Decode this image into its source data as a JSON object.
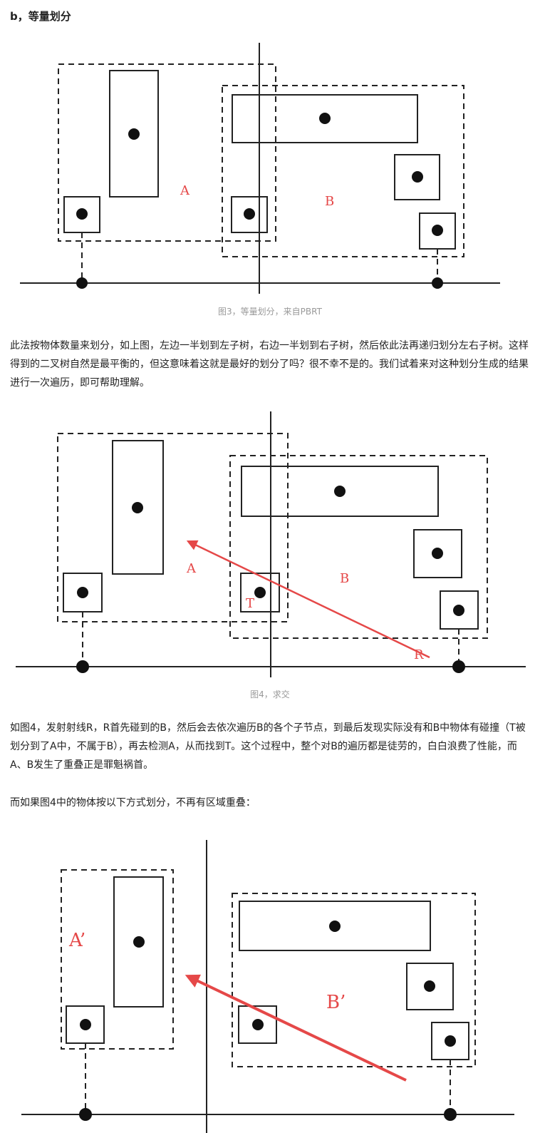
{
  "heading": "b，等量划分",
  "figure3": {
    "caption": "图3，等量划分，来自PBRT",
    "label_a": "A",
    "label_b": "B"
  },
  "paragraph1": "此法按物体数量来划分，如上图，左边一半划到左子树，右边一半划到右子树，然后依此法再递归划分左右子树。这样得到的二叉树自然是最平衡的，但这意味着这就是最好的划分了吗？很不幸不是的。我们试着来对这种划分生成的结果进行一次遍历，即可帮助理解。",
  "figure4": {
    "caption": "图4，求交",
    "label_a": "A",
    "label_b": "B",
    "label_t": "T",
    "label_r": "R"
  },
  "paragraph2": "如图4，发射射线R，R首先碰到的B，然后会去依次遍历B的各个子节点，到最后发现实际没有和B中物体有碰撞（T被划分到了A中，不属于B），再去检测A，从而找到T。这个过程中，整个对B的遍历都是徒劳的，白白浪费了性能，而A、B发生了重叠正是罪魁祸首。",
  "paragraph3": "而如果图4中的物体按以下方式划分，不再有区域重叠：",
  "figure5": {
    "label_a": "A’",
    "label_b": "B’"
  },
  "colors": {
    "label": "#e54848",
    "stroke": "#222222",
    "caption": "#999999"
  }
}
